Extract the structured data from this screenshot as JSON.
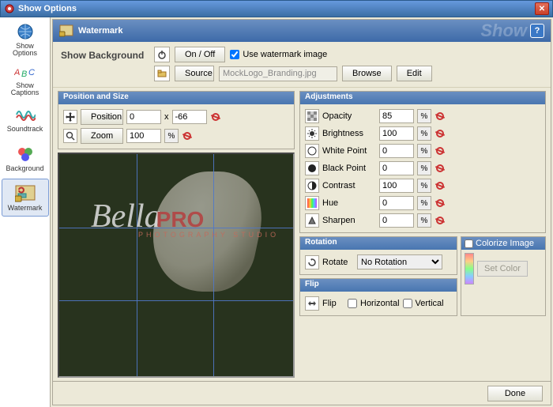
{
  "window": {
    "title": "Show Options"
  },
  "sidebar": {
    "items": [
      {
        "label": "Show Options"
      },
      {
        "label": "Show Captions"
      },
      {
        "label": "Soundtrack"
      },
      {
        "label": "Background"
      },
      {
        "label": "Watermark"
      }
    ]
  },
  "header": {
    "title": "Watermark",
    "ghost": "Show",
    "help": "?"
  },
  "top": {
    "section_label": "Show Background",
    "onoff_label": "On / Off",
    "use_image_label": "Use watermark image",
    "use_image_checked": true,
    "source_label": "Source",
    "source_value": "MockLogo_Branding.jpg",
    "browse": "Browse",
    "edit": "Edit"
  },
  "pos": {
    "title": "Position and Size",
    "position_label": "Position",
    "x": "0",
    "y": "-66",
    "x_sep": "x",
    "zoom_label": "Zoom",
    "zoom": "100"
  },
  "adj": {
    "title": "Adjustments",
    "rows": [
      {
        "label": "Opacity",
        "value": "85"
      },
      {
        "label": "Brightness",
        "value": "100"
      },
      {
        "label": "White Point",
        "value": "0"
      },
      {
        "label": "Black Point",
        "value": "0"
      },
      {
        "label": "Contrast",
        "value": "100"
      },
      {
        "label": "Hue",
        "value": "0"
      },
      {
        "label": "Sharpen",
        "value": "0"
      }
    ],
    "pct": "%"
  },
  "rotation": {
    "title": "Rotation",
    "label": "Rotate",
    "value": "No Rotation"
  },
  "flip": {
    "title": "Flip",
    "label": "Flip",
    "horiz": "Horizontal",
    "vert": "Vertical"
  },
  "colorize": {
    "title": "Colorize Image",
    "setcolor": "Set Color"
  },
  "preview": {
    "brand_script": "Bella",
    "brand_bold": "PRO",
    "brand_sub": "PHOTOGRAPHY STUDIO"
  },
  "footer": {
    "done": "Done"
  }
}
